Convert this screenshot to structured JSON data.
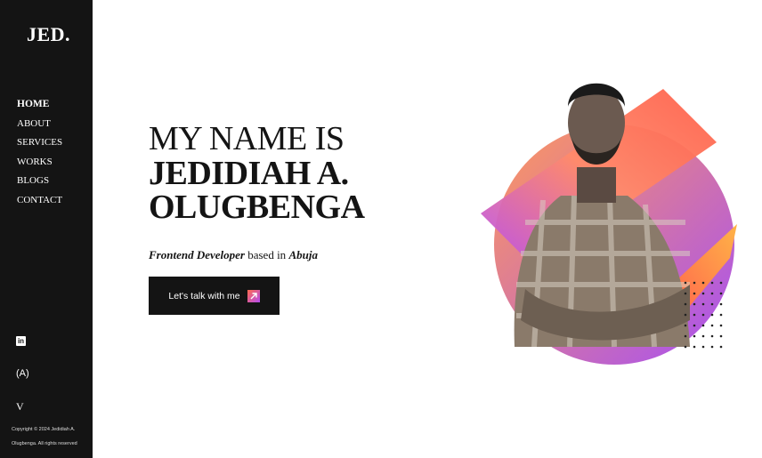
{
  "sidebar": {
    "logo": "JED.",
    "nav": [
      {
        "label": "HOME",
        "active": true
      },
      {
        "label": "ABOUT",
        "active": false
      },
      {
        "label": "SERVICES",
        "active": false
      },
      {
        "label": "WORKS",
        "active": false
      },
      {
        "label": "BLOGS",
        "active": false
      },
      {
        "label": "CONTACT",
        "active": false
      }
    ],
    "social_icons": [
      "linkedin-icon",
      "gatsby-icon",
      "vue-icon"
    ],
    "copyright_line1": "Copyright © 2024 Jedidiah A.",
    "copyright_line2": "Olugbenga. All rights reserved"
  },
  "hero": {
    "line1": "MY NAME IS",
    "name_line1": "JEDIDIAH A.",
    "name_line2": "OLUGBENGA",
    "role": "Frontend Developer",
    "based_in": "based in",
    "location": "Abuja",
    "cta_label": "Let's talk with me"
  },
  "colors": {
    "sidebar_bg": "#141414",
    "accent_start": "#ff6a4d",
    "accent_end": "#b44cf0"
  }
}
